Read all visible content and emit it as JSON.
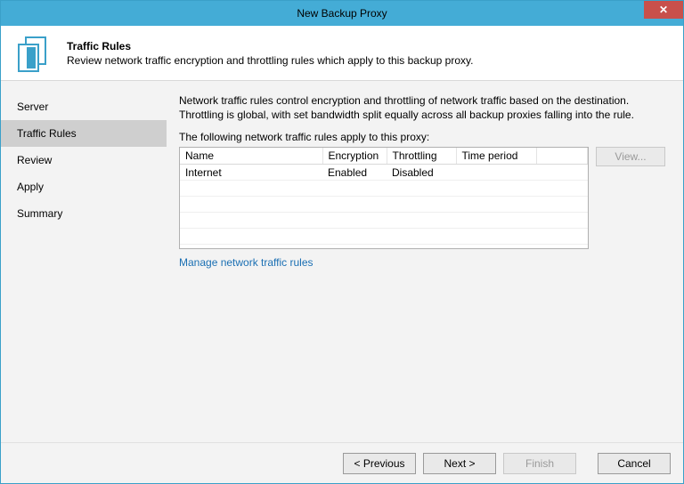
{
  "window": {
    "title": "New Backup Proxy"
  },
  "header": {
    "title": "Traffic Rules",
    "subtitle": "Review network traffic encryption and throttling rules which apply to this backup proxy."
  },
  "sidebar": {
    "steps": [
      "Server",
      "Traffic Rules",
      "Review",
      "Apply",
      "Summary"
    ],
    "activeIndex": 1
  },
  "main": {
    "intro": "Network traffic rules control encryption and throttling of network traffic based on the destination. Throttling is global, with set bandwidth split equally across all backup proxies falling into the rule.",
    "tableLabel": "The following network traffic rules apply to this proxy:",
    "columns": [
      "Name",
      "Encryption",
      "Throttling",
      "Time period"
    ],
    "rows": [
      {
        "name": "Internet",
        "encryption": "Enabled",
        "throttling": "Disabled",
        "timePeriod": ""
      }
    ],
    "viewLabel": "View...",
    "manageLink": "Manage network traffic rules"
  },
  "footer": {
    "previous": "< Previous",
    "next": "Next >",
    "finish": "Finish",
    "cancel": "Cancel"
  }
}
